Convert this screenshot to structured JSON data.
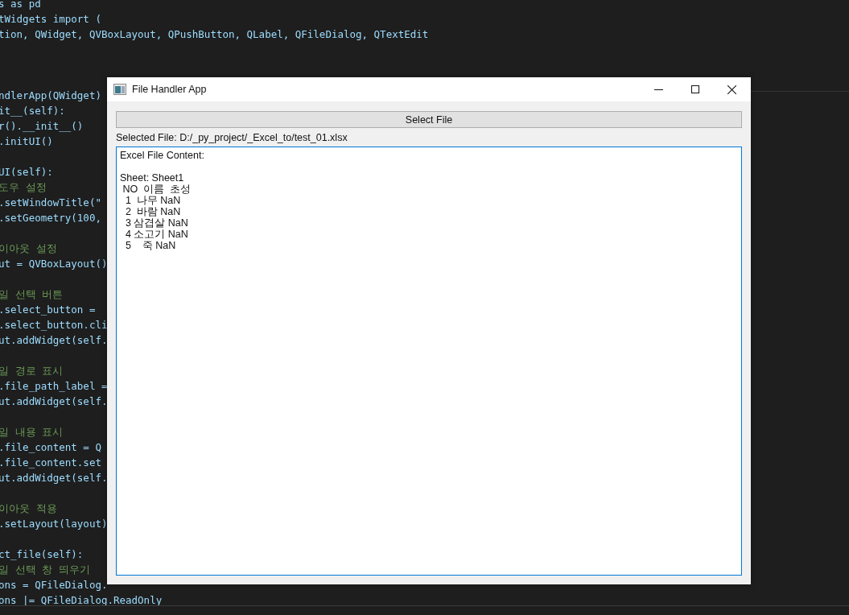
{
  "editor": {
    "lines": [
      {
        "kind": "code",
        "text": "s as pd"
      },
      {
        "kind": "code",
        "text": "tWidgets import ("
      },
      {
        "kind": "code",
        "text": "tion, QWidget, QVBoxLayout, QPushButton, QLabel, QFileDialog, QTextEdit"
      },
      {
        "kind": "blank"
      },
      {
        "kind": "blank"
      },
      {
        "kind": "blank"
      },
      {
        "kind": "code",
        "text": "ndlerApp(QWidget)"
      },
      {
        "kind": "code",
        "text": "it__(self):"
      },
      {
        "kind": "code",
        "text": "r().__init__()"
      },
      {
        "kind": "code",
        "text": ".initUI()"
      },
      {
        "kind": "blank"
      },
      {
        "kind": "code",
        "text": "UI(self):"
      },
      {
        "kind": "comment",
        "text": "도우 설정"
      },
      {
        "kind": "code",
        "text": ".setWindowTitle(\""
      },
      {
        "kind": "code",
        "text": ".setGeometry(100,"
      },
      {
        "kind": "blank"
      },
      {
        "kind": "comment",
        "text": "이아웃 설정"
      },
      {
        "kind": "code",
        "text": "ut = QVBoxLayout()"
      },
      {
        "kind": "blank"
      },
      {
        "kind": "comment",
        "text": "일 선택 버튼"
      },
      {
        "kind": "code",
        "text": ".select_button ="
      },
      {
        "kind": "code",
        "text": ".select_button.cli"
      },
      {
        "kind": "code",
        "text": "ut.addWidget(self."
      },
      {
        "kind": "blank"
      },
      {
        "kind": "comment",
        "text": "일 경로 표시"
      },
      {
        "kind": "code",
        "text": ".file_path_label ="
      },
      {
        "kind": "code",
        "text": "ut.addWidget(self."
      },
      {
        "kind": "blank"
      },
      {
        "kind": "comment",
        "text": "일 내용 표시"
      },
      {
        "kind": "code",
        "text": ".file_content = Q"
      },
      {
        "kind": "code",
        "text": ".file_content.set"
      },
      {
        "kind": "code",
        "text": "ut.addWidget(self."
      },
      {
        "kind": "blank"
      },
      {
        "kind": "comment",
        "text": "이아웃 적용"
      },
      {
        "kind": "code",
        "text": ".setLayout(layout)"
      },
      {
        "kind": "blank"
      },
      {
        "kind": "code",
        "text": "ct_file(self):"
      },
      {
        "kind": "comment",
        "text": "일 선택 창 띄우기"
      },
      {
        "kind": "code",
        "text": "ons = QFileDialog."
      },
      {
        "kind": "code",
        "text": "ons |= QFileDialog.ReadOnly"
      }
    ]
  },
  "window": {
    "title": "File Handler App",
    "select_button": "Select File",
    "path_label": "Selected File: D:/_py_project/_Excel_to/test_01.xlsx",
    "content": {
      "header": "Excel File Content:",
      "sheet": "Sheet: Sheet1",
      "table_lines": [
        " NO  이름  초성",
        "  1  나무 NaN",
        "  2  바람 NaN",
        "  3 삼겹살 NaN",
        "  4 소고기 NaN",
        "  5    죽 NaN"
      ]
    }
  }
}
